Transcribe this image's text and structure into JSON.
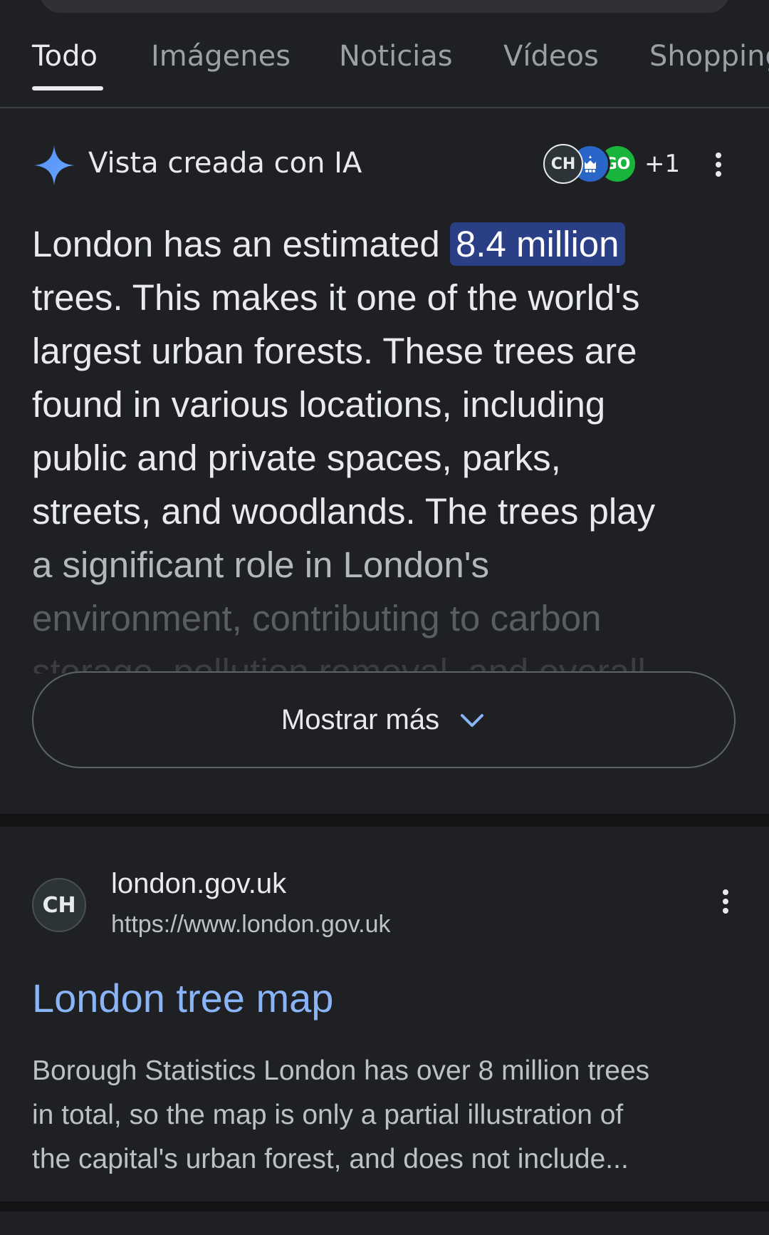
{
  "tabs": [
    {
      "label": "Todo",
      "active": true
    },
    {
      "label": "Imágenes",
      "active": false
    },
    {
      "label": "Noticias",
      "active": false
    },
    {
      "label": "Vídeos",
      "active": false
    },
    {
      "label": "Shopping",
      "active": false
    }
  ],
  "ai_overview": {
    "title": "Vista creada con IA",
    "sources": [
      {
        "text": "CH",
        "icon": "ch-site-icon"
      },
      {
        "text": "",
        "icon": "crown-shield-icon",
        "color": "#2a66c8"
      },
      {
        "text": "GO",
        "icon": "go-site-icon",
        "color": "#18b43c"
      }
    ],
    "more_sources": "+1",
    "text_before": "London has an estimated ",
    "highlight": "8.4 million",
    "lines": [
      "trees. This makes it one of the world's",
      "largest urban forests. These trees are",
      "found in various locations, including",
      "public and private spaces, parks,",
      "streets, and woodlands. The trees play",
      "a significant role in London's",
      "environment, contributing to carbon",
      "storage, pollution removal, and overall"
    ],
    "show_more": "Mostrar más",
    "accent": "#2b3f86"
  },
  "result": {
    "favicon_text": "CH",
    "site_name": "london.gov.uk",
    "url": "https://www.london.gov.uk",
    "title": "London tree map",
    "title_color": "#8ab4f8",
    "snippet_lines": [
      "Borough Statistics London has over 8 million trees",
      "in total, so the map is only a partial illustration of",
      "the capital's urban forest, and does not include..."
    ]
  }
}
